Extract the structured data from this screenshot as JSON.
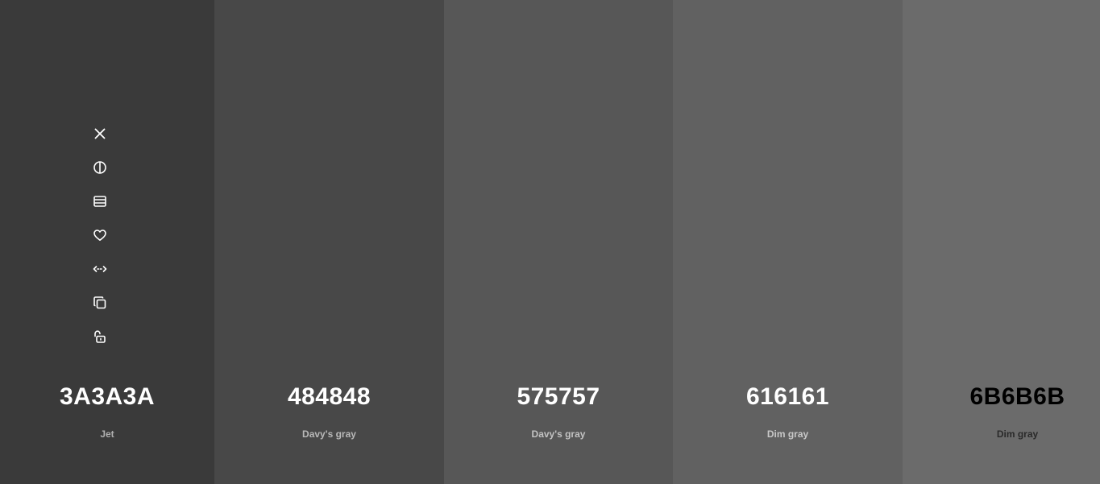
{
  "swatches": [
    {
      "hex": "3A3A3A",
      "name": "Jet",
      "color": "#3a3a3a",
      "text_color": "#ffffff",
      "name_color": "#b0b0b0"
    },
    {
      "hex": "484848",
      "name": "Davy's gray",
      "color": "#484848",
      "text_color": "#ffffff",
      "name_color": "#b8b8b8"
    },
    {
      "hex": "575757",
      "name": "Davy's gray",
      "color": "#575757",
      "text_color": "#ffffff",
      "name_color": "#c2c2c2"
    },
    {
      "hex": "616161",
      "name": "Dim gray",
      "color": "#616161",
      "text_color": "#ffffff",
      "name_color": "#c8c8c8"
    },
    {
      "hex": "6B6B6B",
      "name": "Dim gray",
      "color": "#6b6b6b",
      "text_color": "#000000",
      "name_color": "#2a2a2a"
    }
  ],
  "toolbar": {
    "icons": [
      "close-icon",
      "contrast-icon",
      "view-shades-icon",
      "heart-icon",
      "drag-horizontal-icon",
      "copy-icon",
      "unlock-icon"
    ]
  }
}
